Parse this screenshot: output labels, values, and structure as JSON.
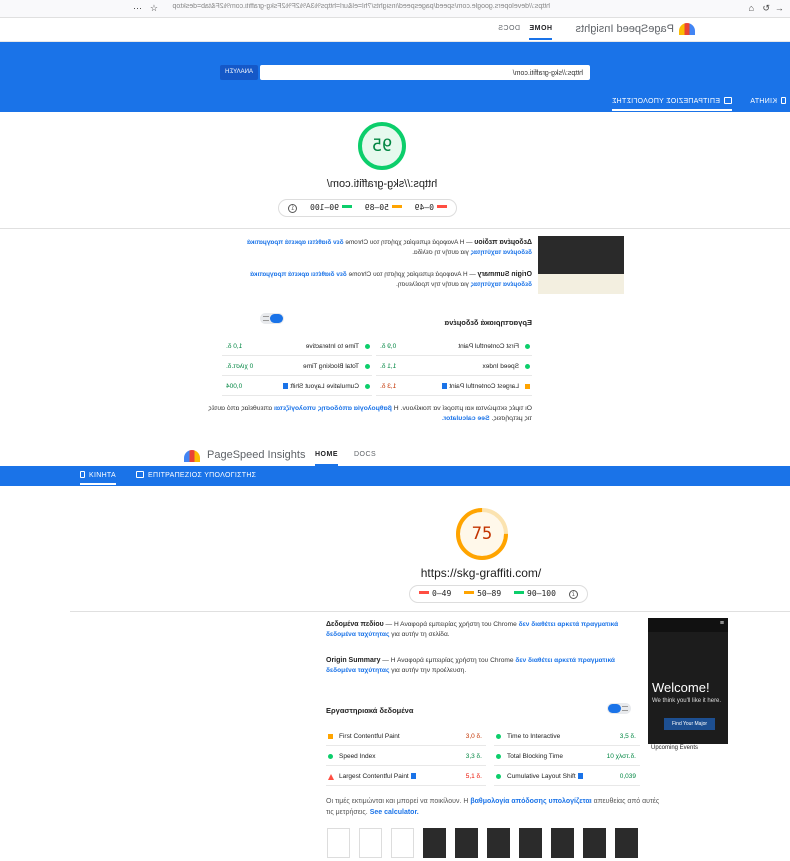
{
  "browser": {
    "url": "https://developers.google.com/speed/pagespeed/insights/?hl=el&url=https%3A%2F%2Fskg-graffiti.com%2F&tab=desktop"
  },
  "app": {
    "brand": "PageSpeed Insights",
    "nav_home": "HOME",
    "nav_docs": "DOCS"
  },
  "search": {
    "url_value": "https://skg-graffiti.com/",
    "analyze_label": "ΑΝΑΛΥΣΗ"
  },
  "tabs": {
    "mobile": "ΚΙΝΗΤΑ",
    "desktop": "ΕΠΙΤΡΑΠΕΖΙΟΣ ΥΠΟΛΟΓΙΣΤΗΣ"
  },
  "legend": {
    "red": "0–49",
    "orange": "50–89",
    "green": "90–100"
  },
  "desktop_report": {
    "score": "95",
    "url": "https://skg-graffiti.com/",
    "field_title": "Δεδομένα πεδίου",
    "field_text": " — Η Αναφορά εμπειρίας χρήστη του Chrome ",
    "field_link": "δεν διαθέτει αρκετά πραγματικά δεδομένα ταχύτητας",
    "field_tail": " για αυτήν τη σελίδα.",
    "origin_title": "Origin Summary",
    "origin_text": " — Η Αναφορά εμπειρίας χρήστη του Chrome ",
    "origin_link": "δεν διαθέτει αρκετά πραγματικά δεδομένα ταχύτητας",
    "origin_tail": " για αυτήν την προέλευση.",
    "lab_title": "Εργαστηριακά δεδομένα",
    "metrics": [
      {
        "name": "First Contentful Paint",
        "value": "0,9 δ.",
        "status": "green"
      },
      {
        "name": "Time to Interactive",
        "value": "1,0 δ.",
        "status": "green"
      },
      {
        "name": "Speed Index",
        "value": "1,1 δ.",
        "status": "green"
      },
      {
        "name": "Total Blocking Time",
        "value": "0 χιλστ.δ.",
        "status": "green"
      },
      {
        "name": "Largest Contentful Paint",
        "value": "1,3 δ.",
        "status": "orange"
      },
      {
        "name": "Cumulative Layout Shift",
        "value": "0,004",
        "status": "green"
      }
    ],
    "note": "Οι τιμές εκτιμώνται και μπορεί να ποικίλουν. Η ",
    "note_link": "βαθμολογία απόδοσης υπολογίζεται",
    "note_tail": " απευθείας από αυτές τις μετρήσεις.",
    "calc_link": "See calculator."
  },
  "mobile_report": {
    "score": "75",
    "url": "https://skg-graffiti.com/",
    "field_title": "Δεδομένα πεδίου",
    "field_text": " — Η Αναφορά εμπειρίας χρήστη του Chrome ",
    "field_link": "δεν διαθέτει αρκετά πραγματικά δεδομένα ταχύτητας",
    "field_tail": " για αυτήν τη σελίδα.",
    "origin_title": "Origin Summary",
    "origin_text": " — Η Αναφορά εμπειρίας χρήστη του Chrome ",
    "origin_link": "δεν διαθέτει αρκετά πραγματικά δεδομένα ταχύτητας",
    "origin_tail": " για αυτήν την προέλευση.",
    "lab_title": "Εργαστηριακά δεδομένα",
    "metrics": [
      {
        "name": "First Contentful Paint",
        "value": "3,0 δ.",
        "status": "orange"
      },
      {
        "name": "Time to Interactive",
        "value": "3,5 δ.",
        "status": "green"
      },
      {
        "name": "Speed Index",
        "value": "3,3 δ.",
        "status": "green"
      },
      {
        "name": "Total Blocking Time",
        "value": "10 χλστ.δ.",
        "status": "green"
      },
      {
        "name": "Largest Contentful Paint",
        "value": "5,1 δ.",
        "status": "red"
      },
      {
        "name": "Cumulative Layout Shift",
        "value": "0,039",
        "status": "green"
      }
    ],
    "note": "Οι τιμές εκτιμώνται και μπορεί να ποικίλουν. Η ",
    "note_link": "βαθμολογία απόδοσης υπολογίζεται",
    "note_tail": " απευθείας από αυτές τις μετρήσεις.",
    "calc_link": "See calculator.",
    "screenshot": {
      "welcome": "Welcome!",
      "sub": "We think you'll like it here.",
      "button": "Find Your Major",
      "footer": "Upcoming Events"
    }
  },
  "colors": {
    "accent": "#1a73e8",
    "pass": "#0cce6b",
    "average": "#ffa400",
    "fail": "#ff4e42"
  }
}
